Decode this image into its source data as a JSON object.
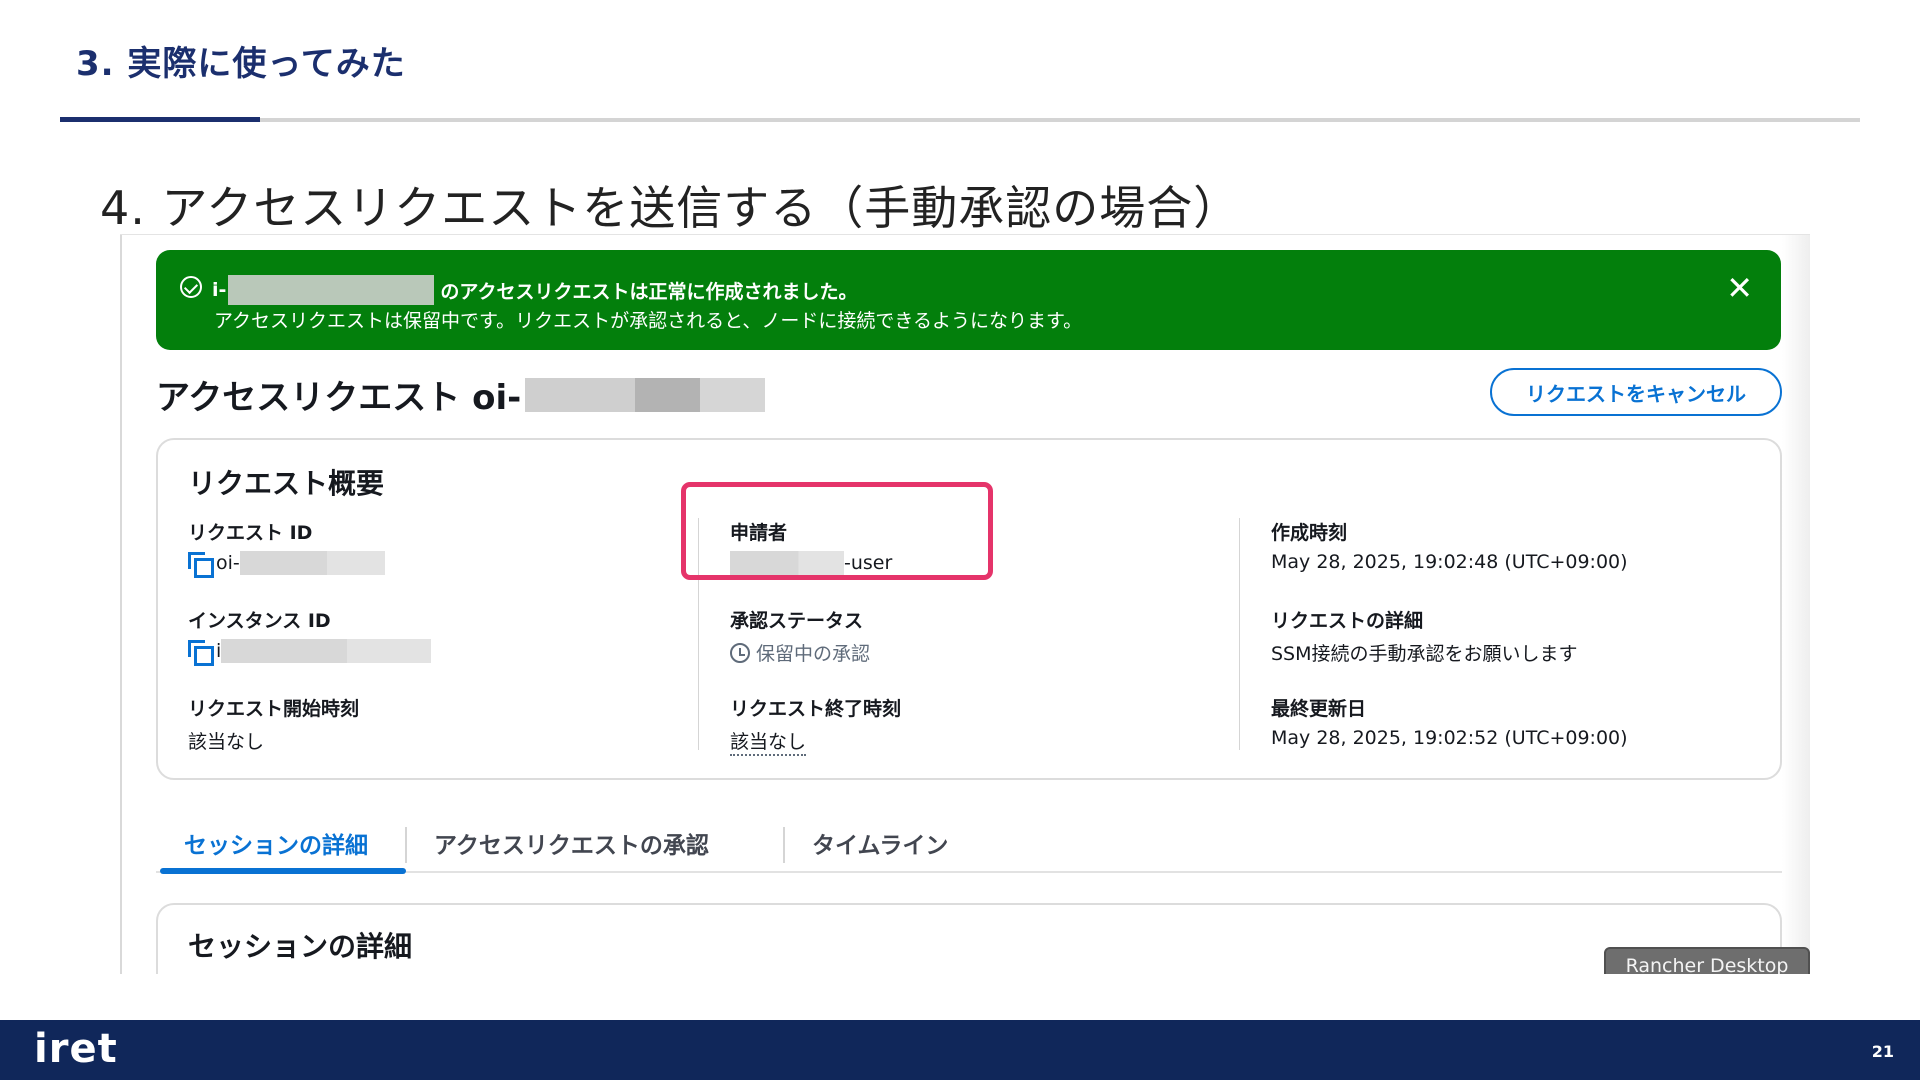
{
  "slide": {
    "section_title": "3. 実際に使ってみた",
    "heading": "4. アクセスリクエストを送信する（手動承認の場合）",
    "footer_logo": "iret",
    "page_number": "21"
  },
  "flash": {
    "line1_prefix": "i-",
    "line1_suffix": "のアクセスリクエストは正常に作成されました。",
    "line2": "アクセスリクエストは保留中です。リクエストが承認されると、ノードに接続できるようになります。",
    "close_glyph": "✕",
    "color": "#037f0c"
  },
  "page_header": {
    "title_prefix": "アクセスリクエスト oi-",
    "cancel_label": "リクエストをキャンセル"
  },
  "summary": {
    "title": "リクエスト概要",
    "request_id": {
      "label": "リクエスト ID",
      "value_prefix": "oi-"
    },
    "instance_id": {
      "label": "インスタンス ID",
      "value_prefix": "i"
    },
    "start_time": {
      "label": "リクエスト開始時刻",
      "value": "該当なし"
    },
    "requester": {
      "label": "申請者",
      "value_suffix": "-user"
    },
    "approval_status": {
      "label": "承認ステータス",
      "value": "保留中の承認"
    },
    "end_time": {
      "label": "リクエスト終了時刻",
      "value": "該当なし"
    },
    "created": {
      "label": "作成時刻",
      "value": "May 28, 2025, 19:02:48 (UTC+09:00)"
    },
    "details": {
      "label": "リクエストの詳細",
      "value": "SSM接続の手動承認をお願いします"
    },
    "updated": {
      "label": "最終更新日",
      "value": "May 28, 2025, 19:02:52 (UTC+09:00)"
    }
  },
  "tabs": [
    {
      "label": "セッションの詳細",
      "active": true
    },
    {
      "label": "アクセスリクエストの承認",
      "active": false
    },
    {
      "label": "タイムライン",
      "active": false
    }
  ],
  "session": {
    "title": "セッションの詳細"
  },
  "tooltip": "Rancher Desktop",
  "colors": {
    "accent_blue": "#0972d3",
    "highlight": "#e5346a",
    "footer_navy": "#10275a",
    "title_navy": "#1b2f6e"
  }
}
